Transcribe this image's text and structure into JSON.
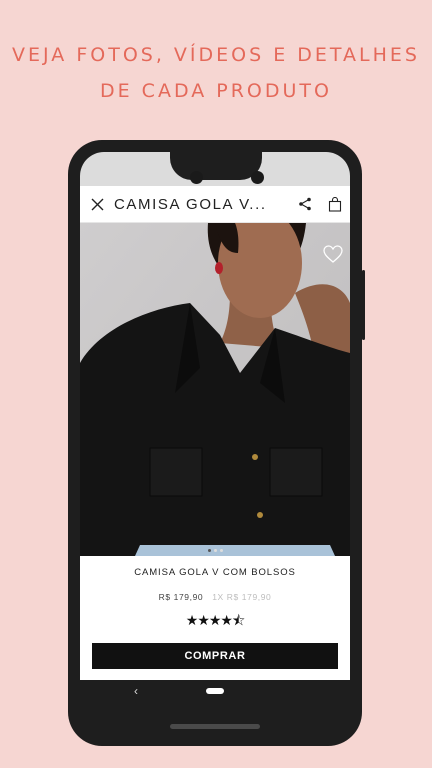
{
  "promo": {
    "line1": "VEJA FOTOS, VÍDEOS E DETALHES",
    "line2": "DE CADA PRODUTO"
  },
  "app": {
    "title": "CAMISA GOLA V...",
    "icons": [
      "close-icon",
      "share-icon",
      "shopping-bag-icon",
      "heart-icon"
    ]
  },
  "product": {
    "name": "CAMISA GOLA V COM BOLSOS",
    "price": "R$ 179,90",
    "installment": "1X R$ 179,90",
    "rating": 4.5,
    "rating_stars": "★★★★⯪",
    "image_index": 1,
    "image_count": 3,
    "buy_label": "COMPRAR"
  },
  "colors": {
    "background": "#f6d6d2",
    "headline": "#e4695a",
    "button": "#111111"
  }
}
